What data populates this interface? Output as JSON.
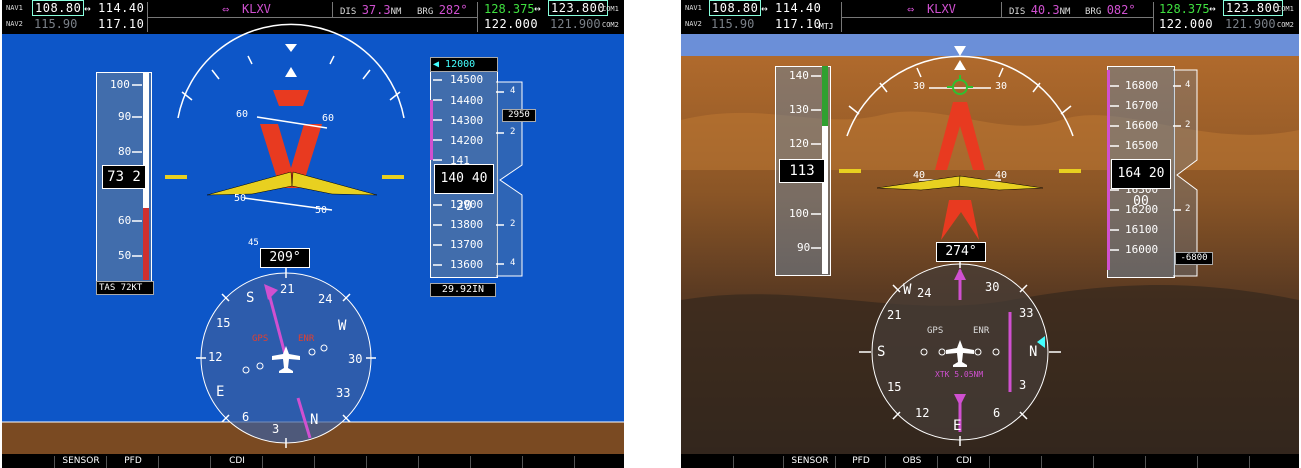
{
  "displays": [
    {
      "nav1_label": "NAV1",
      "nav1_active": "108.80",
      "nav1_arrow": "↔",
      "nav1_standby": "114.40",
      "nav2_label": "NAV2",
      "nav2_active": "115.90",
      "nav2_standby": "117.10",
      "nav2_ident": "",
      "waypoint_arrow": "⇔",
      "waypoint": "KLXV",
      "dis_label": "DIS",
      "dis_value": "37.3",
      "dis_unit": "NM",
      "brg_label": "BRG",
      "brg_value": "282°",
      "com1_active": "128.375",
      "com_arrow": "↔",
      "com1_standby": "123.800",
      "com1_label": "COM1",
      "com2_active": "122.000",
      "com2_standby": "121.900",
      "com2_label": "COM2",
      "airspeed_ticks": [
        "100",
        "90",
        "80",
        "60",
        "50"
      ],
      "airspeed_readout": "73 2",
      "tas": "TAS  72KT",
      "altitude_selected": "12000",
      "altitude_ticks": [
        "14500",
        "14400",
        "14300",
        "14200",
        "141",
        "13900",
        "13800",
        "13700",
        "13600"
      ],
      "altitude_readout": "140 40 20",
      "baro": "29.92IN",
      "vsi_ticks": [
        "4",
        "2",
        "2",
        "4"
      ],
      "vsi_bug": "2950",
      "pitch_labels": [
        "60",
        "60",
        "50",
        "50"
      ],
      "heading": "209°",
      "heading_partial": "45",
      "compass_labels": [
        "21",
        "24",
        "W",
        "30",
        "33",
        "N",
        "3",
        "6",
        "E",
        "12",
        "15",
        "S"
      ],
      "gps": "GPS",
      "enr": "ENR",
      "xtk": "",
      "softkeys": [
        "",
        "SENSOR",
        "PFD",
        "",
        "CDI",
        "",
        "",
        "",
        "",
        "",
        "",
        ""
      ]
    },
    {
      "nav1_label": "NAV1",
      "nav1_active": "108.80",
      "nav1_arrow": "↔",
      "nav1_standby": "114.40",
      "nav2_label": "NAV2",
      "nav2_active": "115.90",
      "nav2_standby": "117.10",
      "nav2_ident": "MTJ",
      "waypoint_arrow": "⇔",
      "waypoint": "KLXV",
      "dis_label": "DIS",
      "dis_value": "40.3",
      "dis_unit": "NM",
      "brg_label": "BRG",
      "brg_value": "082°",
      "com1_active": "128.375",
      "com_arrow": "↔",
      "com1_standby": "123.800",
      "com1_label": "COM1",
      "com2_active": "122.000",
      "com2_standby": "121.900",
      "com2_label": "COM2",
      "airspeed_ticks": [
        "140",
        "130",
        "120",
        "100",
        "90"
      ],
      "airspeed_readout": "113",
      "tas": "",
      "altitude_selected": "",
      "altitude_ticks": [
        "16800",
        "16700",
        "16600",
        "16500",
        "16300",
        "16200",
        "16100",
        "16000"
      ],
      "altitude_readout": "164 20 00",
      "baro": "",
      "vsi_ticks": [
        "4",
        "2",
        "2"
      ],
      "vsi_bug": "-6800",
      "pitch_labels": [
        "30",
        "30",
        "40",
        "40"
      ],
      "heading": "274°",
      "heading_partial": "",
      "compass_labels": [
        "W",
        "30",
        "33",
        "N",
        "3",
        "6",
        "E",
        "12",
        "15",
        "S",
        "21",
        "24"
      ],
      "gps": "GPS",
      "enr": "ENR",
      "xtk": "XTK 5.05NM",
      "softkeys": [
        "",
        "SENSOR",
        "PFD",
        "OBS",
        "CDI",
        "",
        "",
        "",
        "",
        "",
        "",
        ""
      ]
    }
  ],
  "colors": {
    "sky_left": "#0d56c8",
    "ground_left": "#7a4a22",
    "sky_right": "#6b8fd8",
    "terrain_right": "#8a5526",
    "magenta": "#d050d0",
    "com_green": "#3fe03f",
    "pitch_red": "#e83a20",
    "wing_yellow": "#e8d020"
  }
}
